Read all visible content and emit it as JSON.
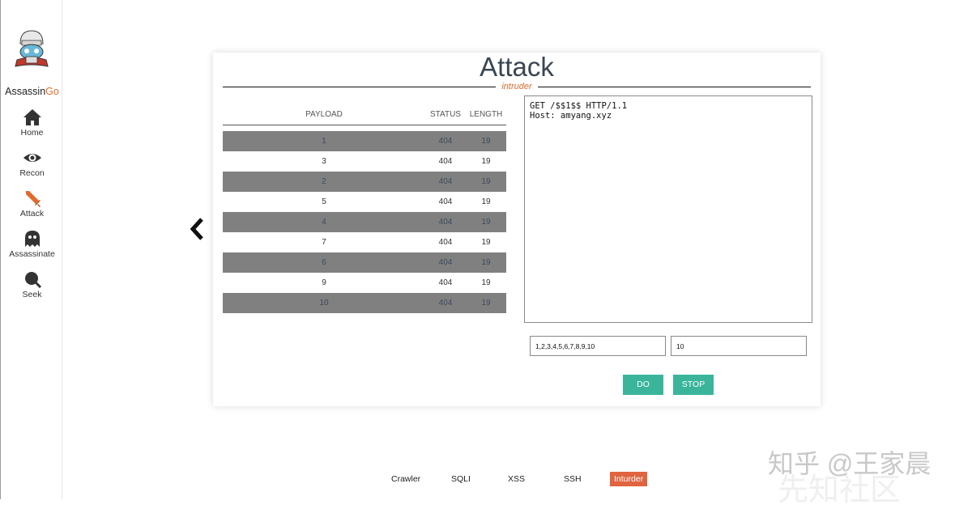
{
  "brand": {
    "name_main": "Assassin",
    "name_accent": "Go"
  },
  "sidebar": {
    "items": [
      {
        "label": "Home",
        "icon": "home-icon"
      },
      {
        "label": "Recon",
        "icon": "eye-icon"
      },
      {
        "label": "Attack",
        "icon": "sword-icon"
      },
      {
        "label": "Assassinate",
        "icon": "ghost-icon"
      },
      {
        "label": "Seek",
        "icon": "search-icon"
      }
    ]
  },
  "card": {
    "title": "Attack",
    "subtitle": "intruder",
    "table": {
      "headers": {
        "payload": "PAYLOAD",
        "status": "STATUS",
        "length": "LENGTH"
      },
      "rows": [
        {
          "payload": "1",
          "status": "404",
          "length": "19"
        },
        {
          "payload": "3",
          "status": "404",
          "length": "19"
        },
        {
          "payload": "2",
          "status": "404",
          "length": "19"
        },
        {
          "payload": "5",
          "status": "404",
          "length": "19"
        },
        {
          "payload": "4",
          "status": "404",
          "length": "19"
        },
        {
          "payload": "7",
          "status": "404",
          "length": "19"
        },
        {
          "payload": "6",
          "status": "404",
          "length": "19"
        },
        {
          "payload": "9",
          "status": "404",
          "length": "19"
        },
        {
          "payload": "10",
          "status": "404",
          "length": "19"
        }
      ]
    },
    "request": "GET /$$1$$ HTTP/1.1\nHost: amyang.xyz",
    "payloads_value": "1,2,3,4,5,6,7,8,9,10",
    "threads_value": "10",
    "do_label": "DO",
    "stop_label": "STOP"
  },
  "bottom_nav": [
    {
      "label": "Crawler",
      "active": false
    },
    {
      "label": "SQLI",
      "active": false
    },
    {
      "label": "XSS",
      "active": false
    },
    {
      "label": "SSH",
      "active": false
    },
    {
      "label": "Inturder",
      "active": true
    }
  ],
  "watermark": {
    "line1": "知乎 @王家晨",
    "line2": "先知社区"
  },
  "colors": {
    "accent": "#e06b2e",
    "button": "#3ab59b",
    "active_tab": "#e0643f",
    "row_odd": "#808080"
  }
}
